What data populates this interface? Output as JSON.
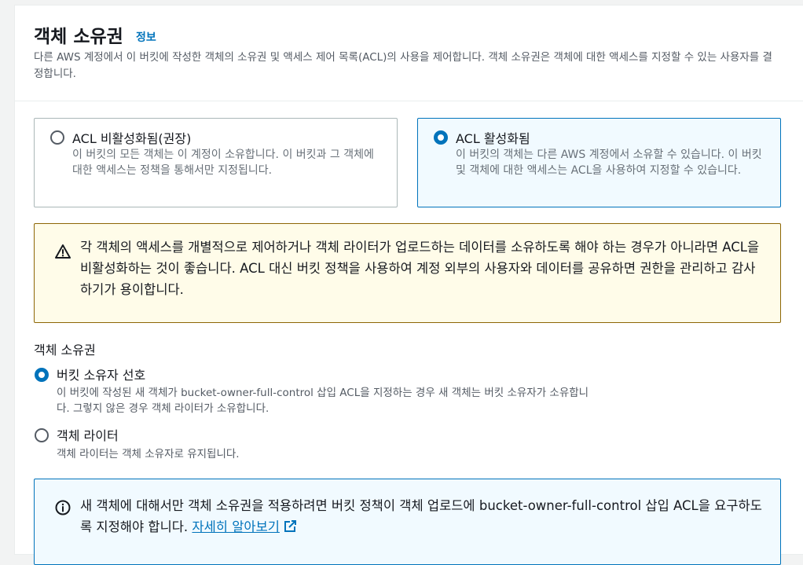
{
  "header": {
    "title": "객체 소유권",
    "info_link": "정보",
    "description": "다른 AWS 계정에서 이 버킷에 작성한 객체의 소유권 및 액세스 제어 목록(ACL)의 사용을 제어합니다. 객체 소유권은 객체에 대한 액세스를 지정할 수 있는 사용자를 결정합니다."
  },
  "acl_options": [
    {
      "label": "ACL 비활성화됨(권장)",
      "description": "이 버킷의 모든 객체는 이 계정이 소유합니다. 이 버킷과 그 객체에 대한 액세스는 정책을 통해서만 지정됩니다.",
      "selected": false
    },
    {
      "label": "ACL 활성화됨",
      "description": "이 버킷의 객체는 다른 AWS 계정에서 소유할 수 있습니다. 이 버킷 및 객체에 대한 액세스는 ACL을 사용하여 지정할 수 있습니다.",
      "selected": true
    }
  ],
  "warning": {
    "text": "각 객체의 액세스를 개별적으로 제어하거나 객체 라이터가 업로드하는 데이터를 소유하도록 해야 하는 경우가 아니라면 ACL을 비활성화하는 것이 좋습니다. ACL 대신 버킷 정책을 사용하여 계정 외부의 사용자와 데이터를 공유하면 권한을 관리하고 감사하기가 용이합니다."
  },
  "ownership": {
    "label": "객체 소유권",
    "options": [
      {
        "label": "버킷 소유자 선호",
        "description": "이 버킷에 작성된 새 객체가 bucket-owner-full-control 삽입 ACL을 지정하는 경우 새 객체는 버킷 소유자가 소유합니다. 그렇지 않은 경우 객체 라이터가 소유합니다.",
        "selected": true
      },
      {
        "label": "객체 라이터",
        "description": "객체 라이터는 객체 소유자로 유지됩니다.",
        "selected": false
      }
    ]
  },
  "info_box": {
    "text": "새 객체에 대해서만 객체 소유권을 적용하려면 버킷 정책이 객체 업로드에 bucket-owner-full-control 삽입 ACL을 요구하도록 지정해야 합니다. ",
    "link_text": "자세히 알아보기"
  },
  "colors": {
    "accent": "#0073bb",
    "warning_border": "#8d6605",
    "warning_bg": "#fffce9",
    "info_bg": "#f1faff"
  },
  "icons": {
    "warning": "warning-triangle-icon",
    "info": "info-circle-icon",
    "external": "external-link-icon"
  }
}
